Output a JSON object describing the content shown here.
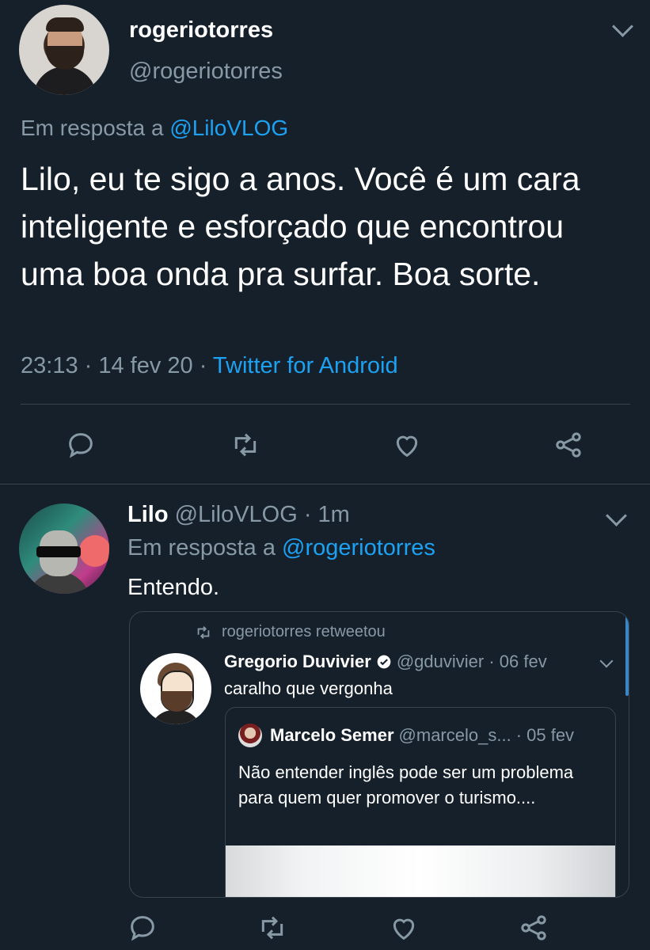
{
  "tweet1": {
    "name": "rogeriotorres",
    "handle": "@rogeriotorres",
    "reply_prefix": "Em resposta a ",
    "reply_to": "@LiloVLOG",
    "text": "Lilo,  eu te sigo a anos. Você é um cara inteligente e esforçado que encontrou uma boa onda pra surfar. Boa sorte.",
    "time_date": "23:13 · 14 fev 20 · ",
    "source": "Twitter for Android",
    "actions": [
      "reply-icon",
      "retweet-icon",
      "like-icon",
      "share-icon"
    ]
  },
  "tweet2": {
    "name": "Lilo",
    "handle_time": "@LiloVLOG · 1m",
    "reply_prefix": "Em resposta a ",
    "reply_to": "@rogeriotorres",
    "text": "Entendo.",
    "embedded": {
      "retweet_label": "rogeriotorres retweetou",
      "author_name": "Gregorio Duvivier",
      "author_handle_date": "@gduvivier · 06 fev",
      "text": "caralho que vergonha",
      "quote": {
        "author_name": "Marcelo Semer",
        "author_handle": "@marcelo_s...",
        "date": "· 05 fev",
        "text": "Não entender inglês pode ser um problema para quem quer promover o turismo...."
      }
    }
  },
  "colors": {
    "background": "#15202b",
    "text": "#ffffff",
    "muted": "#8899a6",
    "link": "#1da1f2",
    "divider": "#38444d"
  }
}
